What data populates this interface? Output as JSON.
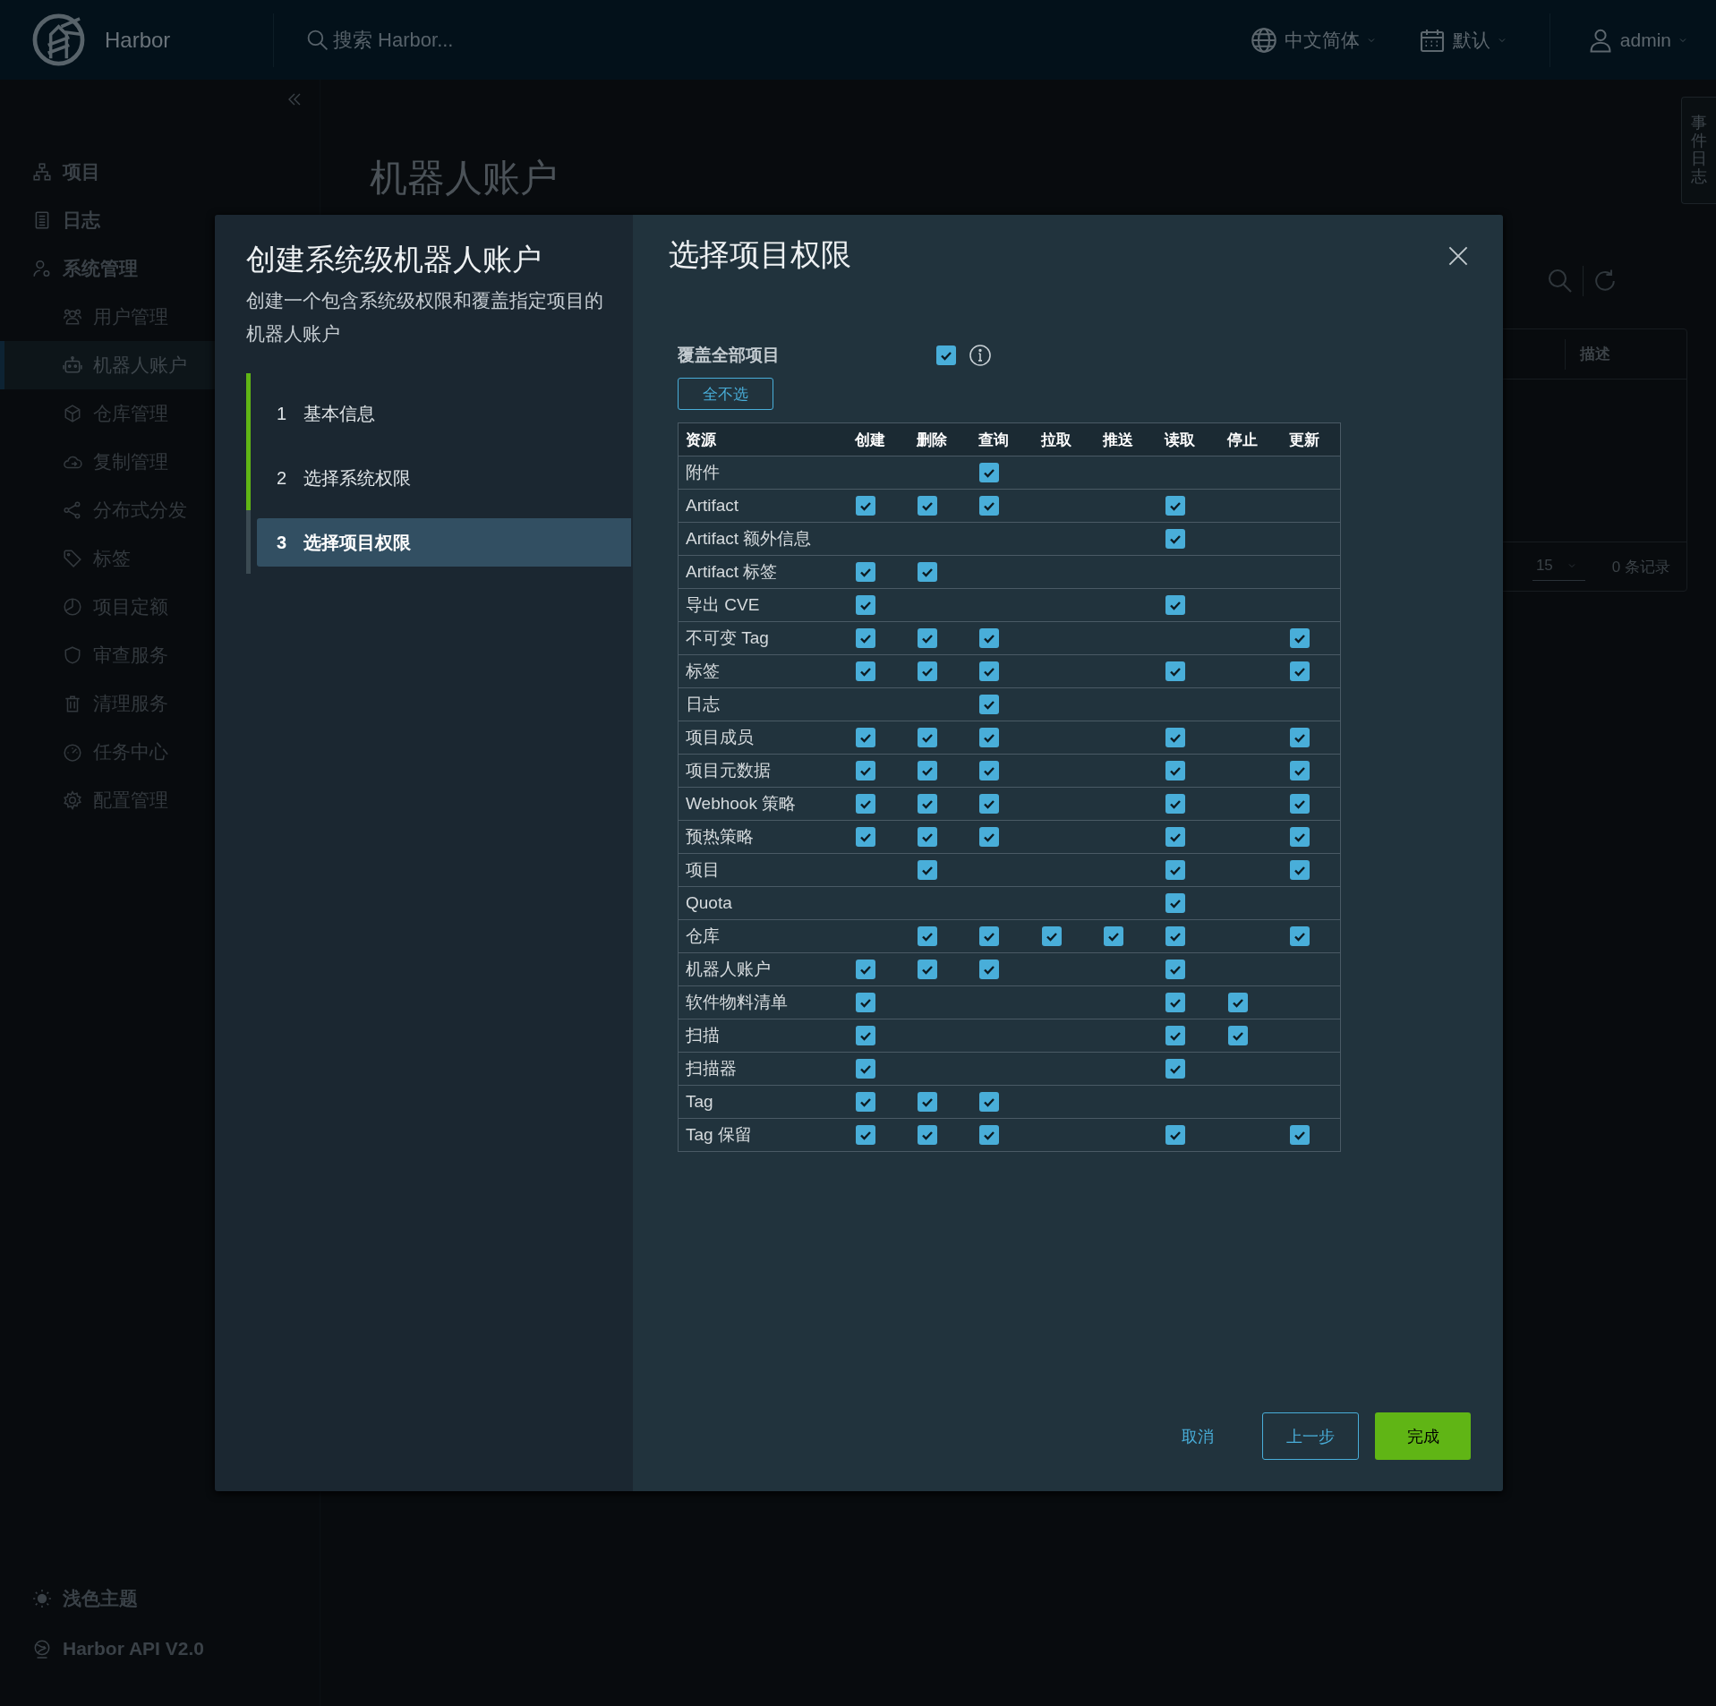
{
  "header": {
    "brand": "Harbor",
    "search": {
      "placeholder": "搜索 Harbor..."
    },
    "language": "中文简体",
    "date_format": "默认",
    "user": "admin"
  },
  "sidebar": {
    "items": [
      {
        "label": "项目",
        "selected": false
      },
      {
        "label": "日志",
        "selected": false
      },
      {
        "label": "系统管理",
        "selected": false,
        "children": [
          {
            "label": "用户管理",
            "selected": false
          },
          {
            "label": "机器人账户",
            "selected": true
          },
          {
            "label": "仓库管理",
            "selected": false
          },
          {
            "label": "复制管理",
            "selected": false
          },
          {
            "label": "分布式分发",
            "selected": false
          },
          {
            "label": "标签",
            "selected": false
          },
          {
            "label": "项目定额",
            "selected": false
          },
          {
            "label": "审查服务",
            "selected": false
          },
          {
            "label": "清理服务",
            "selected": false
          },
          {
            "label": "任务中心",
            "selected": false
          },
          {
            "label": "配置管理",
            "selected": false
          }
        ]
      }
    ],
    "theme_toggle": "浅色主题",
    "api_link": "Harbor API V2.0"
  },
  "event_log_tab": "事件日志",
  "page": {
    "title": "机器人账户",
    "table": {
      "columns": [
        "描述"
      ],
      "page_size": "15",
      "total": "0 条记录"
    }
  },
  "dialog": {
    "title": "创建系统级机器人账户",
    "description": "创建一个包含系统级权限和覆盖指定项目的机器人账户",
    "steps": [
      {
        "number": "1",
        "label": "基本信息",
        "completed": true,
        "selected": false
      },
      {
        "number": "2",
        "label": "选择系统权限",
        "completed": true,
        "selected": false
      },
      {
        "number": "3",
        "label": "选择项目权限",
        "completed": false,
        "selected": true
      }
    ],
    "panel_title": "选择项目权限",
    "cover_all": {
      "label": "覆盖全部项目",
      "checked": true
    },
    "deselect_all": "全不选",
    "permissions": {
      "columns": [
        "资源",
        "创建",
        "删除",
        "查询",
        "拉取",
        "推送",
        "读取",
        "停止",
        "更新"
      ],
      "rows": [
        {
          "resource": "附件",
          "checks": [
            false,
            false,
            true,
            false,
            false,
            false,
            false,
            false
          ]
        },
        {
          "resource": "Artifact",
          "checks": [
            true,
            true,
            true,
            false,
            false,
            true,
            false,
            false
          ]
        },
        {
          "resource": "Artifact 额外信息",
          "checks": [
            false,
            false,
            false,
            false,
            false,
            true,
            false,
            false
          ]
        },
        {
          "resource": "Artifact 标签",
          "checks": [
            true,
            true,
            false,
            false,
            false,
            false,
            false,
            false
          ]
        },
        {
          "resource": "导出 CVE",
          "checks": [
            true,
            false,
            false,
            false,
            false,
            true,
            false,
            false
          ]
        },
        {
          "resource": "不可变 Tag",
          "checks": [
            true,
            true,
            true,
            false,
            false,
            false,
            false,
            true
          ]
        },
        {
          "resource": "标签",
          "checks": [
            true,
            true,
            true,
            false,
            false,
            true,
            false,
            true
          ]
        },
        {
          "resource": "日志",
          "checks": [
            false,
            false,
            true,
            false,
            false,
            false,
            false,
            false
          ]
        },
        {
          "resource": "项目成员",
          "checks": [
            true,
            true,
            true,
            false,
            false,
            true,
            false,
            true
          ]
        },
        {
          "resource": "项目元数据",
          "checks": [
            true,
            true,
            true,
            false,
            false,
            true,
            false,
            true
          ]
        },
        {
          "resource": "Webhook 策略",
          "checks": [
            true,
            true,
            true,
            false,
            false,
            true,
            false,
            true
          ]
        },
        {
          "resource": "预热策略",
          "checks": [
            true,
            true,
            true,
            false,
            false,
            true,
            false,
            true
          ]
        },
        {
          "resource": "项目",
          "checks": [
            false,
            true,
            false,
            false,
            false,
            true,
            false,
            true
          ]
        },
        {
          "resource": "Quota",
          "checks": [
            false,
            false,
            false,
            false,
            false,
            true,
            false,
            false
          ]
        },
        {
          "resource": "仓库",
          "checks": [
            false,
            true,
            true,
            true,
            true,
            true,
            false,
            true
          ]
        },
        {
          "resource": "机器人账户",
          "checks": [
            true,
            true,
            true,
            false,
            false,
            true,
            false,
            false
          ]
        },
        {
          "resource": "软件物料清单",
          "checks": [
            true,
            false,
            false,
            false,
            false,
            true,
            true,
            false
          ]
        },
        {
          "resource": "扫描",
          "checks": [
            true,
            false,
            false,
            false,
            false,
            true,
            true,
            false
          ]
        },
        {
          "resource": "扫描器",
          "checks": [
            true,
            false,
            false,
            false,
            false,
            true,
            false,
            false
          ]
        },
        {
          "resource": "Tag",
          "checks": [
            true,
            true,
            true,
            false,
            false,
            false,
            false,
            false
          ]
        },
        {
          "resource": "Tag 保留",
          "checks": [
            true,
            true,
            true,
            false,
            false,
            true,
            false,
            true
          ]
        }
      ]
    },
    "buttons": [
      {
        "label": "取消",
        "kind": "link"
      },
      {
        "label": "上一步",
        "kind": "outline"
      },
      {
        "label": "完成",
        "kind": "primary"
      }
    ]
  }
}
